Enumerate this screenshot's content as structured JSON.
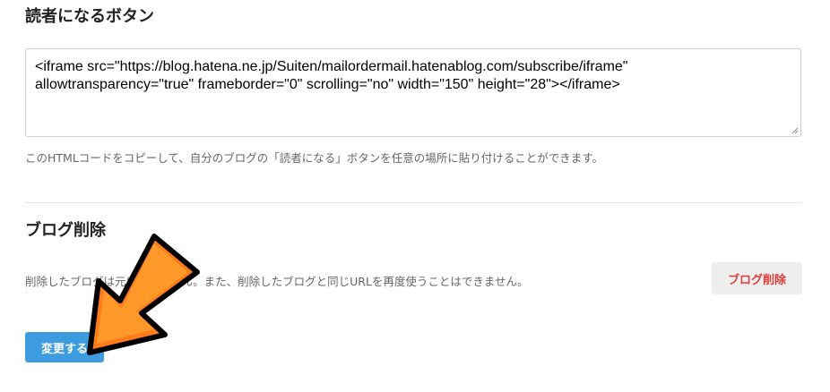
{
  "reader_button": {
    "title": "読者になるボタン",
    "code_line1": "<iframe src=\"https://blog.hatena.ne.jp/Suiten/mailordermail.hatenablog.com/subscribe/iframe\"",
    "code_line2": "allowtransparency=\"true\" frameborder=\"0\" scrolling=\"no\" width=\"150\" height=\"28\"></iframe>",
    "help_text": "このHTMLコードをコピーして、自分のブログの「読者になる」ボタンを任意の場所に貼り付けることができます。"
  },
  "blog_delete": {
    "title": "ブログ削除",
    "description": "削除したブログは元に戻せません。また、削除したブログと同じURLを再度使うことはできません。",
    "button_label": "ブログ削除"
  },
  "submit": {
    "label": "変更する"
  },
  "colors": {
    "primary": "#3d9ce0",
    "danger": "#e03c3c",
    "arrow_fill": "#ff7a1a",
    "arrow_outline": "#000000"
  },
  "icons": {
    "annotation": "arrow-pointer-icon",
    "resize": "resize-grip-icon"
  }
}
